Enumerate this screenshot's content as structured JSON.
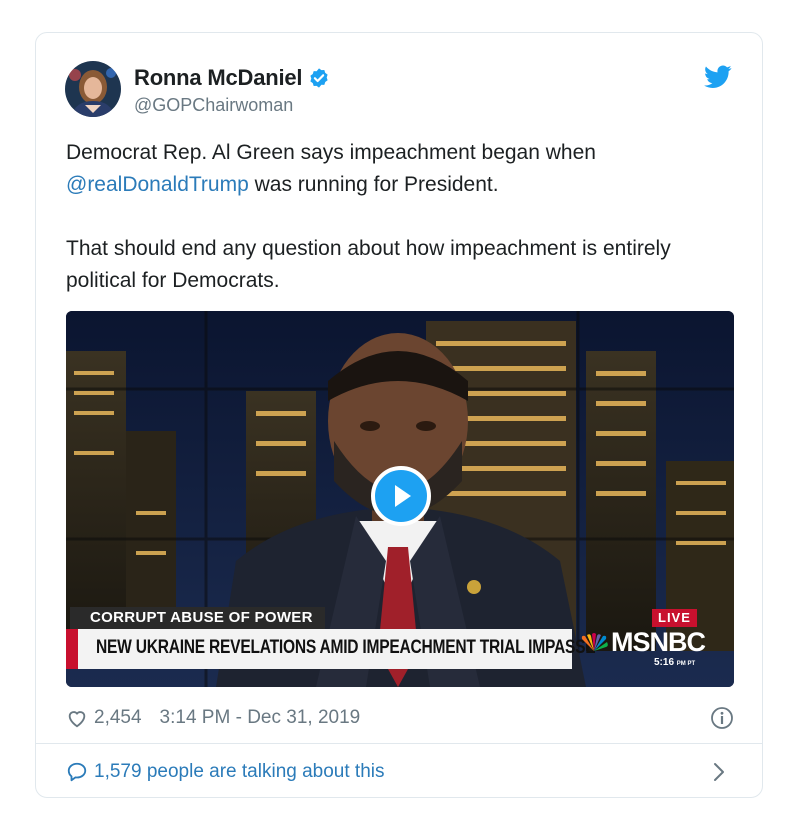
{
  "author": {
    "name": "Ronna McDaniel",
    "handle": "@GOPChairwoman",
    "verified": true
  },
  "tweet": {
    "line1_pre": "Democrat Rep. Al Green says impeachment began when",
    "mention": "@realDonaldTrump",
    "line2_post": " was running for President.",
    "paragraph2": "That should end any question about how impeachment is entirely political for Democrats."
  },
  "video": {
    "kicker": "CORRUPT ABUSE OF POWER",
    "headline": "NEW UKRAINE REVELATIONS AMID IMPEACHMENT TRIAL IMPASSE",
    "live_badge": "LIVE",
    "network": "MSNBC",
    "clock_time": "5:16",
    "clock_ampm": "PM PT"
  },
  "meta": {
    "likes": "2,454",
    "timestamp": "3:14 PM - Dec 31, 2019"
  },
  "footer": {
    "talking": "1,579 people are talking about this"
  },
  "icons": {
    "verified": "verified-badge-icon",
    "brand": "twitter-bird-icon",
    "like": "heart-icon",
    "info": "info-icon",
    "reply": "speech-bubble-icon",
    "more": "chevron-right-icon",
    "play": "play-icon"
  },
  "colors": {
    "link": "#2b7bb9",
    "twitter_blue": "#1da1f2",
    "muted": "#697882",
    "msnbc_red": "#c8102e"
  }
}
